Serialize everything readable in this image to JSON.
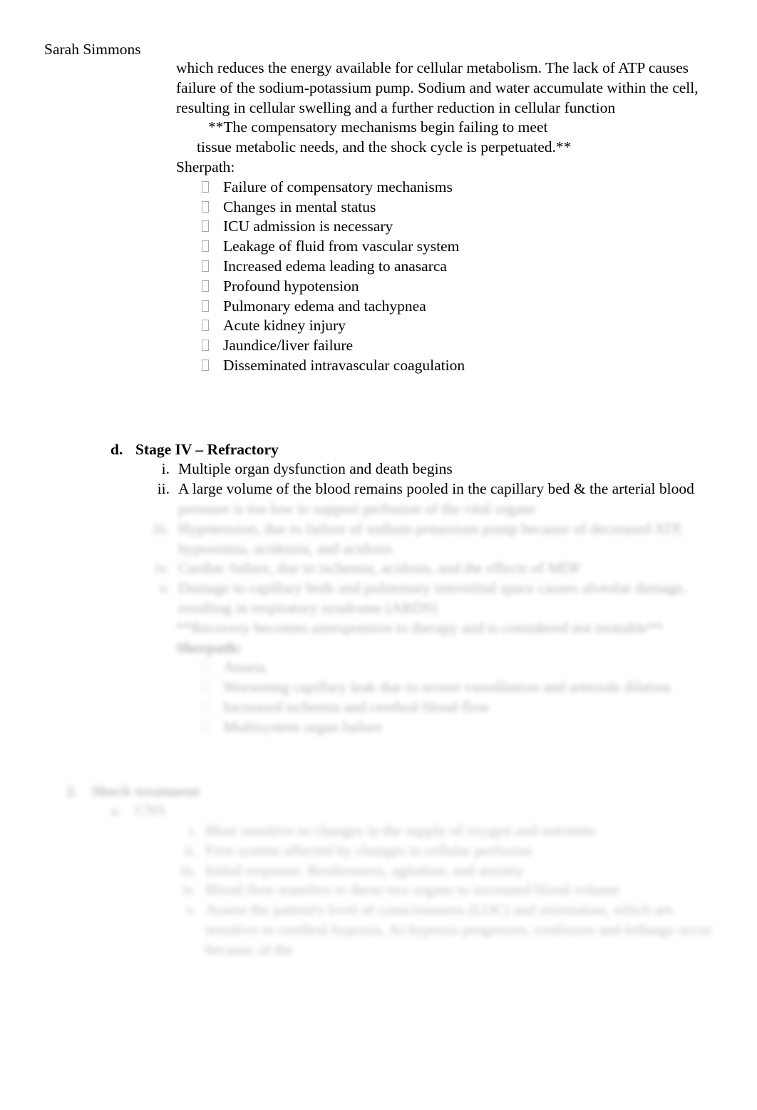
{
  "document": {
    "author": "Sarah Simmons",
    "background_color": "#ffffff",
    "text_color": "#000000",
    "bullet_glyph_name": "wingdings-missing-glyph-box"
  },
  "intro_paragraph": {
    "lines": [
      "which reduces the energy available for cellular metabolism. The lack of ATP causes",
      "failure of the sodium-potassium pump. Sodium and water accumulate within the cell,",
      "resulting in cellular swelling and a further reduction in cellular function"
    ],
    "emphasis_lines": [
      "**The compensatory mechanisms begin failing to meet",
      "tissue metabolic needs, and the shock cycle is perpetuated.**"
    ],
    "source_label": "Sherpath:"
  },
  "sherpath_list": {
    "items": [
      "Failure of compensatory mechanisms",
      "Changes in mental status",
      "ICU admission is necessary",
      "Leakage of fluid from vascular system",
      "Increased edema leading to anasarca",
      "Profound hypotension",
      "Pulmonary edema and tachypnea",
      "Acute kidney injury",
      "Jaundice/liver failure",
      "Disseminated intravascular coagulation"
    ]
  },
  "stage_four": {
    "marker": "d.",
    "heading": "Stage IV – Refractory",
    "items": [
      {
        "marker": "i.",
        "text": "Multiple organ dysfunction and death begins"
      },
      {
        "marker": "ii.",
        "text": "A large volume of the blood remains pooled in the capillary bed & the arterial blood"
      }
    ]
  },
  "faded_stage_four": {
    "continuation_line": "pressure is too low to support perfusion of the vital organs",
    "items": [
      {
        "marker": "iii.",
        "text": "Hypotension, due to failure of sodium-potassium pump because of decreased ATP, hypoxemia, acidemia, and acidosis"
      },
      {
        "marker": "iv.",
        "text": "Cardiac failure, due to ischemia, acidosis, and the effects of MDF"
      },
      {
        "marker": "v.",
        "text": "Damage to capillary beds and pulmonary interstitial space causes alveolar damage, resulting in respiratory syndrome (ARDS)"
      }
    ],
    "emphasis_line": "**Recovery becomes unresponsive to therapy and is considered not treatable**",
    "source_label": "Sherpath:",
    "sub_items": [
      "Anuria",
      "Worsening capillary leak due to severe vasodilation and arteriole dilation",
      "Increased ischemia and cerebral blood flow",
      "Multisystem organ failure"
    ]
  },
  "faded_assessment": {
    "marker": "2.",
    "heading": "Shock treatment",
    "sub_marker": "a.",
    "sub_heading": "CNS",
    "items": [
      {
        "marker": "i.",
        "text": "Most sensitive to changes in the supply of oxygen and nutrients"
      },
      {
        "marker": "ii.",
        "text": "First system affected by changes in cellular perfusion"
      },
      {
        "marker": "iii.",
        "text": "Initial response: Restlessness, agitation, and anxiety"
      },
      {
        "marker": "iv.",
        "text": "Blood flow transfers to these two organs to increased blood volume"
      },
      {
        "marker": "v.",
        "text": "Assess the patient's level of consciousness (LOC) and orientation, which are sensitive to cerebral hypoxia. As hypoxia progresses, confusion and lethargy occur because of the"
      }
    ]
  }
}
